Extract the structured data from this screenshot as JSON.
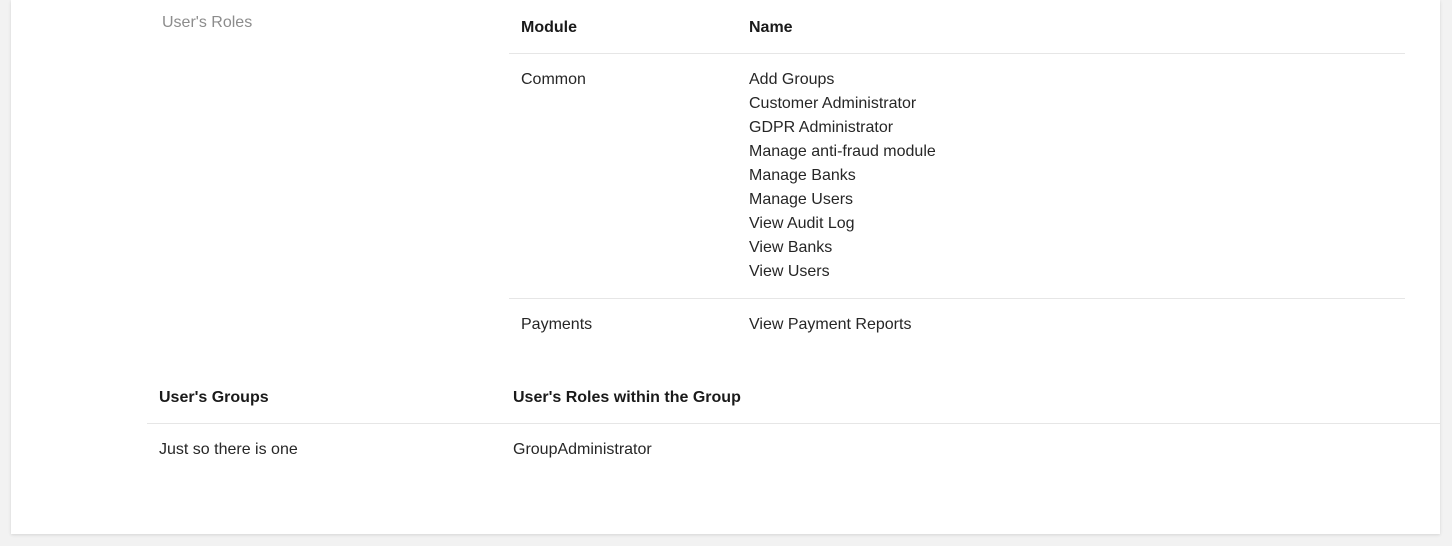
{
  "user_roles": {
    "label": "User's Roles",
    "columns": {
      "module": "Module",
      "name": "Name"
    },
    "rows": [
      {
        "module": "Common",
        "names": [
          "Add Groups",
          "Customer Administrator",
          "GDPR Administrator",
          "Manage anti-fraud module",
          "Manage Banks",
          "Manage Users",
          "View Audit Log",
          "View Banks",
          "View Users"
        ]
      },
      {
        "module": "Payments",
        "names": [
          "View Payment Reports"
        ]
      }
    ]
  },
  "user_groups": {
    "columns": {
      "group": "User's Groups",
      "roles": "User's Roles within the Group"
    },
    "rows": [
      {
        "group": "Just so there is one",
        "roles": "GroupAdministrator"
      }
    ]
  }
}
